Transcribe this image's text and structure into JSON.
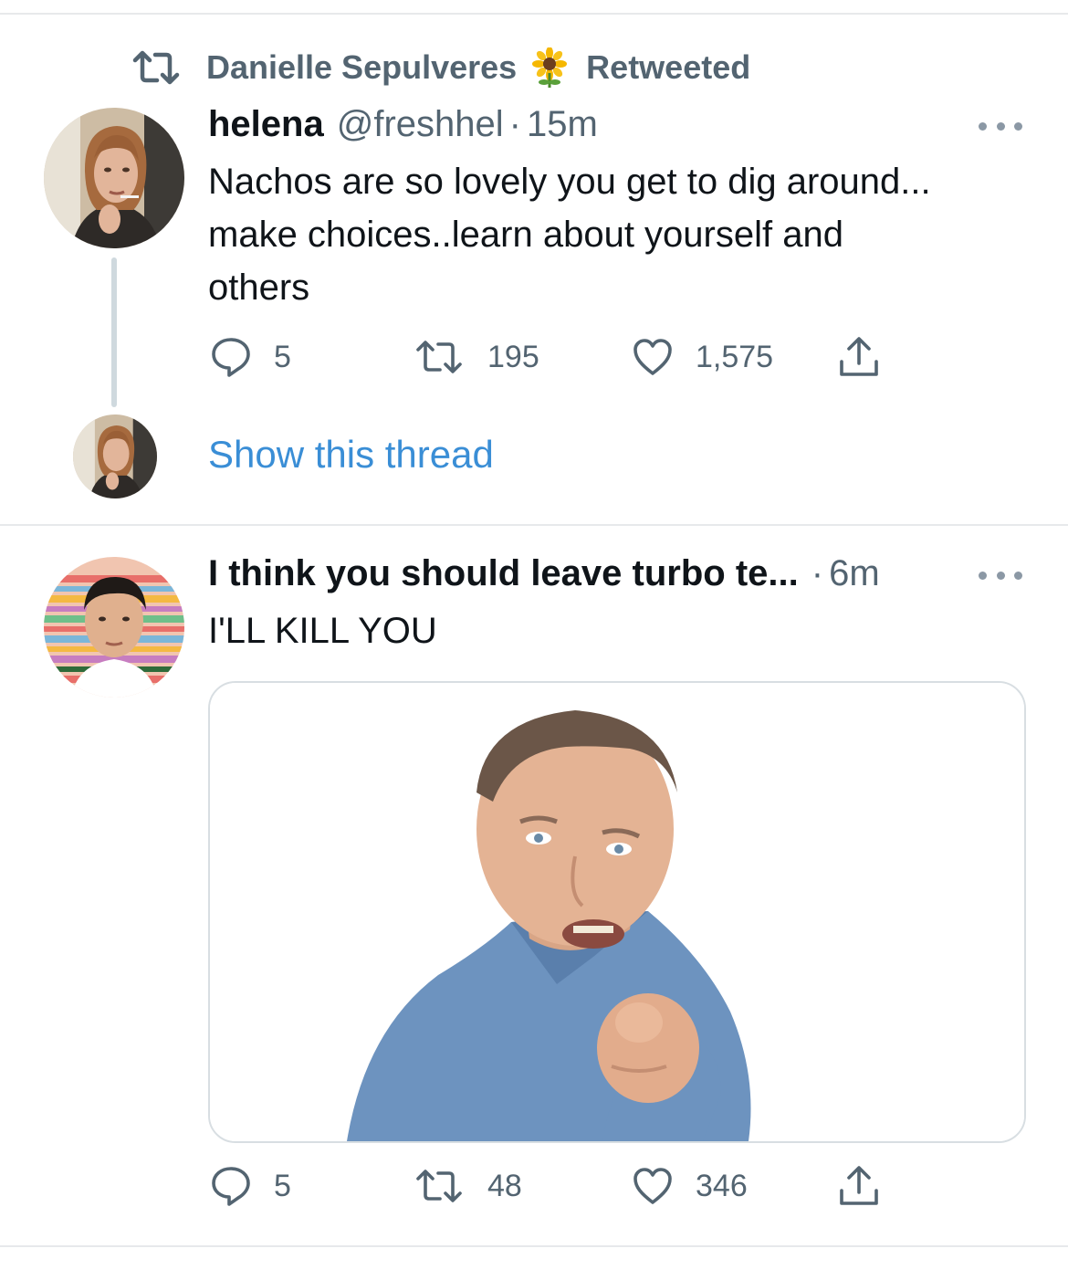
{
  "retweet_header": {
    "retweeter_name": "Danielle Sepulveres",
    "label": "Retweeted"
  },
  "tweet1": {
    "display_name": "helena",
    "handle": "@freshhel",
    "separator": "·",
    "time": "15m",
    "text_lines": [
      "Nachos are so lovely you get to dig around...",
      "make choices..learn about yourself and",
      "others"
    ],
    "replies": "5",
    "retweets": "195",
    "likes": "1,575",
    "show_thread": "Show this thread"
  },
  "tweet2": {
    "display_name": "I think you should leave turbo te...",
    "separator": "·",
    "time": "6m",
    "text": "I'LL KILL YOU",
    "replies": "5",
    "retweets": "48",
    "likes": "346"
  },
  "colors": {
    "secondary_text": "#536471",
    "link": "#3a8ed6",
    "divider": "#e7e9eb"
  },
  "icons": [
    "retweet-icon",
    "sunflower-icon",
    "more-icon",
    "reply-icon",
    "like-icon",
    "share-icon"
  ]
}
